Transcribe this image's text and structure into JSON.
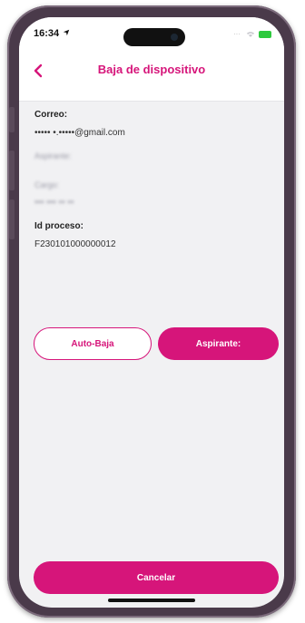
{
  "status_bar": {
    "time": "16:34",
    "signal": "···"
  },
  "header": {
    "title": "Baja de dispositivo"
  },
  "details": {
    "correo_label": "Correo:",
    "correo_value": "••••• •.•••••@gmail.com",
    "aspirante_label": "Aspirante:",
    "cargo_label": "Cargo:",
    "cargo_value": "••• ••• •• ••",
    "id_proceso_label": "Id proceso:",
    "id_proceso_value": "F230101000000012"
  },
  "actions": {
    "auto_baja_label": "Auto-Baja",
    "aspirante_label": "Aspirante:",
    "cancelar_label": "Cancelar"
  },
  "colors": {
    "accent": "#d6157a",
    "background": "#f1f1f3",
    "battery": "#2ec93e"
  },
  "icons": {
    "back": "chevron-left-icon",
    "location": "location-arrow-icon",
    "battery": "battery-icon"
  }
}
